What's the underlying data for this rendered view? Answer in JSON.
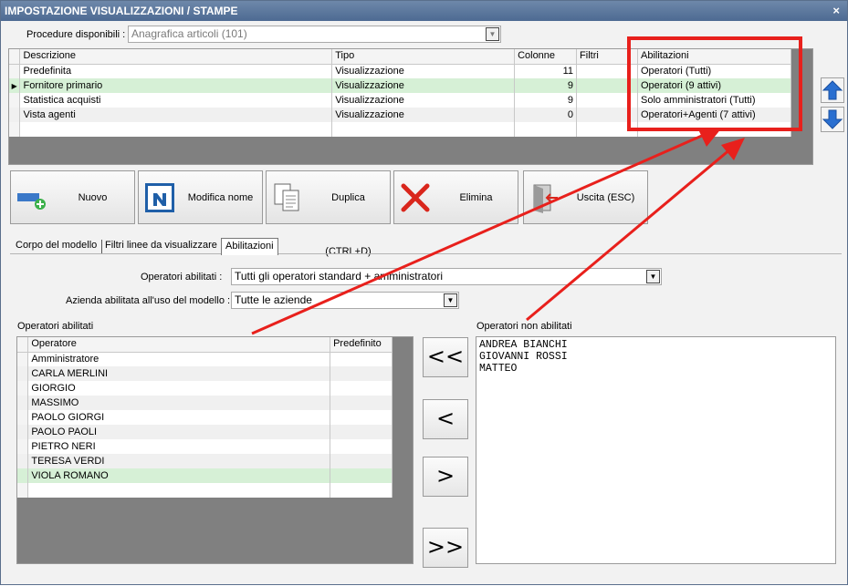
{
  "window": {
    "title": "IMPOSTAZIONE VISUALIZZAZIONI / STAMPE",
    "close": "×"
  },
  "procedure": {
    "label": "Procedure disponibili :",
    "value": "Anagrafica articoli (101)"
  },
  "models": {
    "headers": [
      "Descrizione",
      "Tipo",
      "Colonne",
      "Filtri",
      "Abilitazioni"
    ],
    "rows": [
      {
        "desc": "Predefinita",
        "tipo": "Visualizzazione",
        "colonne": "11",
        "filtri": "",
        "abil": "Operatori (Tutti)"
      },
      {
        "desc": "Fornitore primario",
        "tipo": "Visualizzazione",
        "colonne": "9",
        "filtri": "",
        "abil": "Operatori (9 attivi)"
      },
      {
        "desc": "Statistica acquisti",
        "tipo": "Visualizzazione",
        "colonne": "9",
        "filtri": "",
        "abil": "Solo amministratori (Tutti)"
      },
      {
        "desc": "Vista agenti",
        "tipo": "Visualizzazione",
        "colonne": "0",
        "filtri": "",
        "abil": "Operatori+Agenti (7 attivi)"
      }
    ],
    "selected_row": 1
  },
  "toolbar": {
    "nuovo": "Nuovo",
    "modifica": "Modifica nome",
    "duplica": "Duplica (CTRL+D)",
    "elimina": "Elimina",
    "uscita": "Uscita (ESC)"
  },
  "tabs": [
    "Corpo del modello",
    "Filtri linee da visualizzare",
    "Abilitazioni"
  ],
  "active_tab": 2,
  "abilitazioni": {
    "operatori_label": "Operatori abilitati :",
    "operatori_value": "Tutti gli operatori standard + amministratori",
    "azienda_label": "Azienda abilitata all'uso del modello :",
    "azienda_value": "Tutte le aziende",
    "enabled_title": "Operatori abilitati",
    "disabled_title": "Operatori non abilitati",
    "enabled_headers": [
      "Operatore",
      "Predefinito"
    ],
    "enabled": [
      "Amministratore",
      "CARLA MERLINI",
      "GIORGIO",
      "MASSIMO",
      "PAOLO GIORGI",
      "PAOLO PAOLI",
      "PIETRO NERI",
      "TERESA VERDI",
      "VIOLA ROMANO"
    ],
    "enabled_selected": 8,
    "disabled": [
      "ANDREA BIANCHI",
      "GIOVANNI ROSSI",
      "MATTEO"
    ],
    "move_all_left": "<<",
    "move_left": "<",
    "move_right": ">",
    "move_all_right": ">>"
  },
  "colors": {
    "titlebar": "#4d6a92",
    "selected_row": "#d6f0d6",
    "annotation": "#e8201c",
    "arrow_blue": "#2a6fd0"
  }
}
